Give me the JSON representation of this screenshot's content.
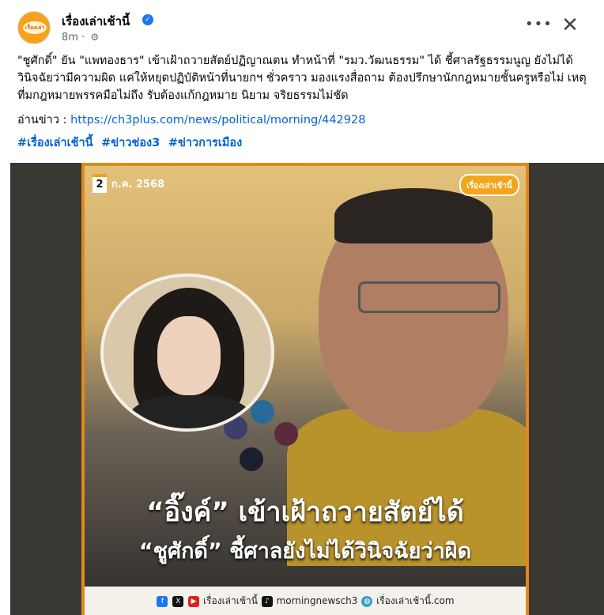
{
  "post": {
    "page_name": "เรื่องเล่าเช้านี้",
    "time": "8m",
    "privacy_icon": "gear-icon",
    "more_label": "•••",
    "close_label": "✕",
    "body": "\"ชูศักดิ์\" ยัน \"แพทองธาร\" เข้าเฝ้าถวายสัตย์ปฏิญาณตน ทำหน้าที่ \"รมว.วัฒนธรรม\" ได้ ชี้ศาลรัฐธรรมนูญ ยังไม่ได้วินิจฉัยว่ามีความผิด แค่ให้หยุดปฏิบัติหน้าที่นายกฯ ชั่วคราว มองแรงสื่อถาม ต้องปรึกษานักกฎหมายชั้นครูหรือไม่ เหตุที่มกฎหมายพรรคมือไม่ถึง รับต้องแก้กฎหมาย นิยาม จริยธรรมไม่ชัด",
    "read_prefix": "อ่านข่าว : ",
    "read_link": "https://ch3plus.com/news/political/morning/442928",
    "hashtags": [
      "#เรื่องเล่าเช้านี้",
      "#ข่าวช่อง3",
      "#ข่าวการเมือง"
    ]
  },
  "image": {
    "date_num": "2",
    "date_text": "ก.ค. 2568",
    "logo_text": "เรื่องเล่าเช้านี้",
    "headline_1": "“อิ๊งค์” เข้าเฝ้าถวายสัตย์ได้",
    "headline_2": "“ชูศักดิ์” ชี้ศาลยังไม่ได้วินิจฉัยว่าผิด",
    "footer_1": "เรื่องเล่าเช้านี้",
    "footer_2": "morningnewsch3",
    "footer_3": "เรื่องเล่าเช้านี้.com"
  },
  "colors": {
    "link": "#0064d1",
    "accent": "#e08a1c",
    "verified": "#1877f2"
  }
}
